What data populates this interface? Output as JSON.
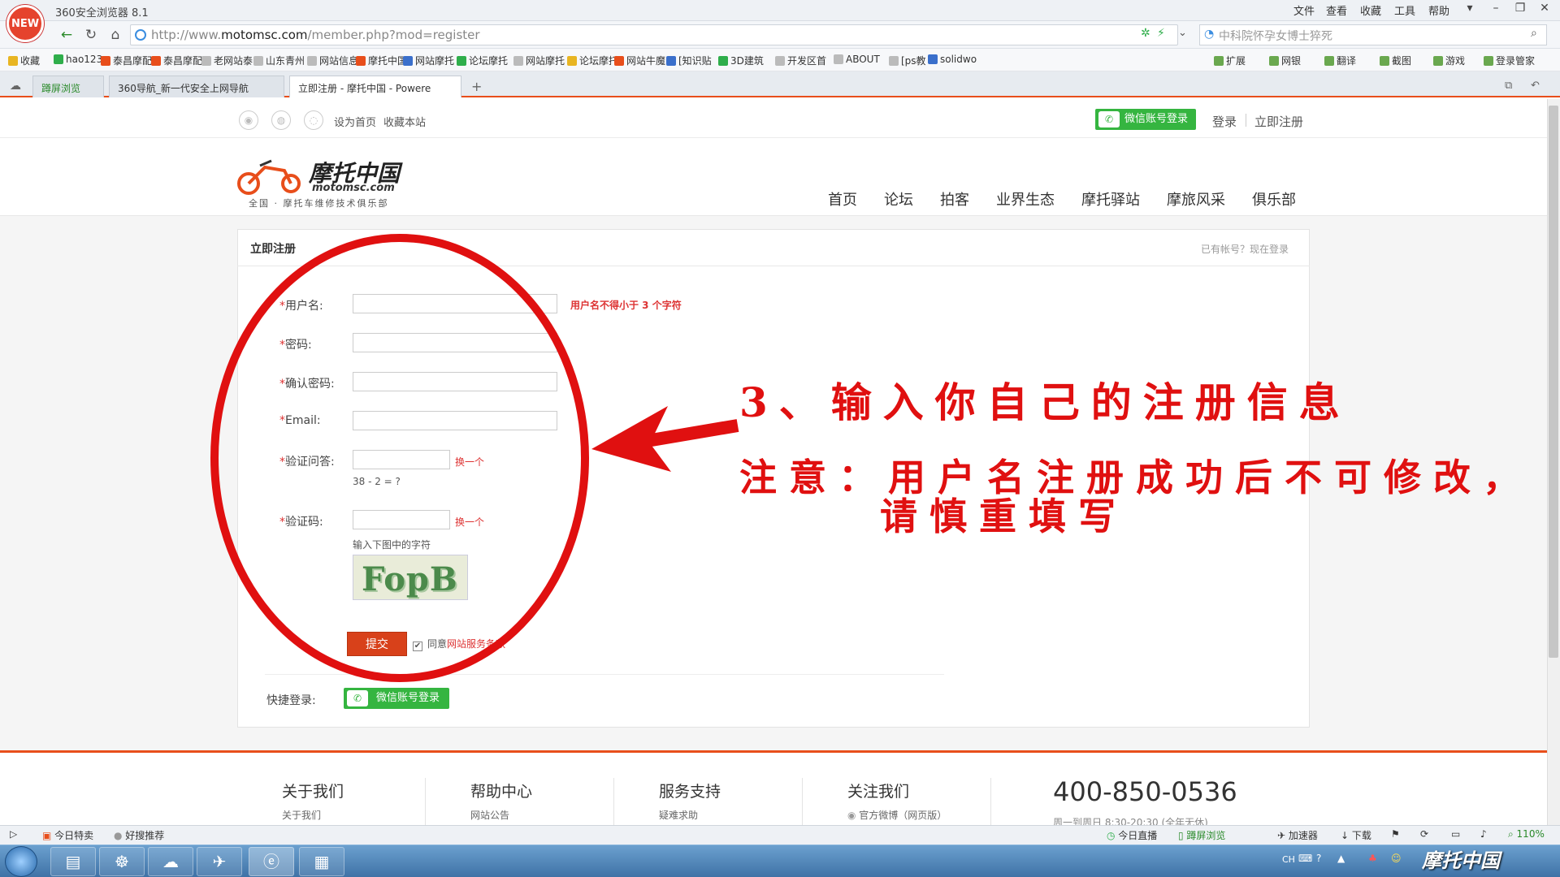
{
  "browser": {
    "title": "360安全浏览器 8.1",
    "badge": "NEW",
    "menu": [
      "文件",
      "查看",
      "收藏",
      "工具",
      "帮助"
    ],
    "url_host": "motomsc.com",
    "url_prefix": "http://www.",
    "url_path": "/member.php?mod=register",
    "search_placeholder": "中科院怀孕女博士猝死",
    "bookmarks": [
      "收藏",
      "hao123",
      "泰昌摩配",
      "泰昌摩配",
      "老网站泰",
      "山东青州",
      "网站信息",
      "摩托中国",
      "网站摩托",
      "论坛摩托",
      "网站摩托",
      "论坛摩托",
      "网站牛魔",
      "[知识贴",
      "3D建筑",
      "开发区首",
      "ABOUT",
      "[ps教",
      "solidwo"
    ],
    "tools": [
      "扩展",
      "网银",
      "翻译",
      "截图",
      "游戏",
      "登录管家"
    ],
    "tabs": [
      "蹲屏浏览",
      "360导航_新一代安全上网导航",
      "立即注册 - 摩托中国 - Powere"
    ]
  },
  "site": {
    "top_links": [
      "设为首页",
      "收藏本站"
    ],
    "wechat_login": "微信账号登录",
    "login": "登录",
    "register": "立即注册",
    "logo_cn": "摩托中国",
    "logo_en": "motomsc.com",
    "logo_slogan": "全国 · 摩托车维修技术俱乐部",
    "nav": [
      "首页",
      "论坛",
      "拍客",
      "业界生态",
      "摩托驿站",
      "摩旅风采",
      "俱乐部"
    ]
  },
  "form": {
    "title": "立即注册",
    "login_hint": "已有帐号？现在登录",
    "username_label": "用户名:",
    "username_tip": "用户名不得小于 3 个字符",
    "password_label": "密码:",
    "confirm_label": "确认密码:",
    "email_label": "Email:",
    "question_label": "验证问答:",
    "question_text": "38 - 2 = ?",
    "captcha_label": "验证码:",
    "captcha_hint": "输入下图中的字符",
    "captcha_code": "FopB",
    "swap": "换一个",
    "submit": "提交",
    "agree_prefix": "同意",
    "agree_link": "网站服务条款",
    "quick_login": "快捷登录:",
    "wechat_login": "微信账号登录"
  },
  "annotation": {
    "step": "3、输入你自己的注册信息",
    "note_line1": "注意：用户名注册成功后不可修改，",
    "note_line2": "请慎重填写",
    "color": "#e01010"
  },
  "footer": {
    "cols": [
      {
        "title": "关于我们",
        "sub": "关于我们"
      },
      {
        "title": "帮助中心",
        "sub": "网站公告"
      },
      {
        "title": "服务支持",
        "sub": "疑难求助"
      },
      {
        "title": "关注我们",
        "sub": "官方微博（网页版）"
      }
    ],
    "phone": "400-850-0536",
    "phone_sub": "周一到周日 8:30-20:30 (全年无休)"
  },
  "statusbar": {
    "left": [
      "今日特卖",
      "好搜推荐"
    ],
    "right": [
      "今日直播",
      "蹲屏浏览",
      "加速器",
      "下载"
    ],
    "zoom": "110%"
  },
  "taskbar": {
    "lang": "CH",
    "watermark": "摩托中国"
  },
  "colors": {
    "accent": "#e84e1b",
    "wechat": "#35b540",
    "required": "#dd3333"
  }
}
